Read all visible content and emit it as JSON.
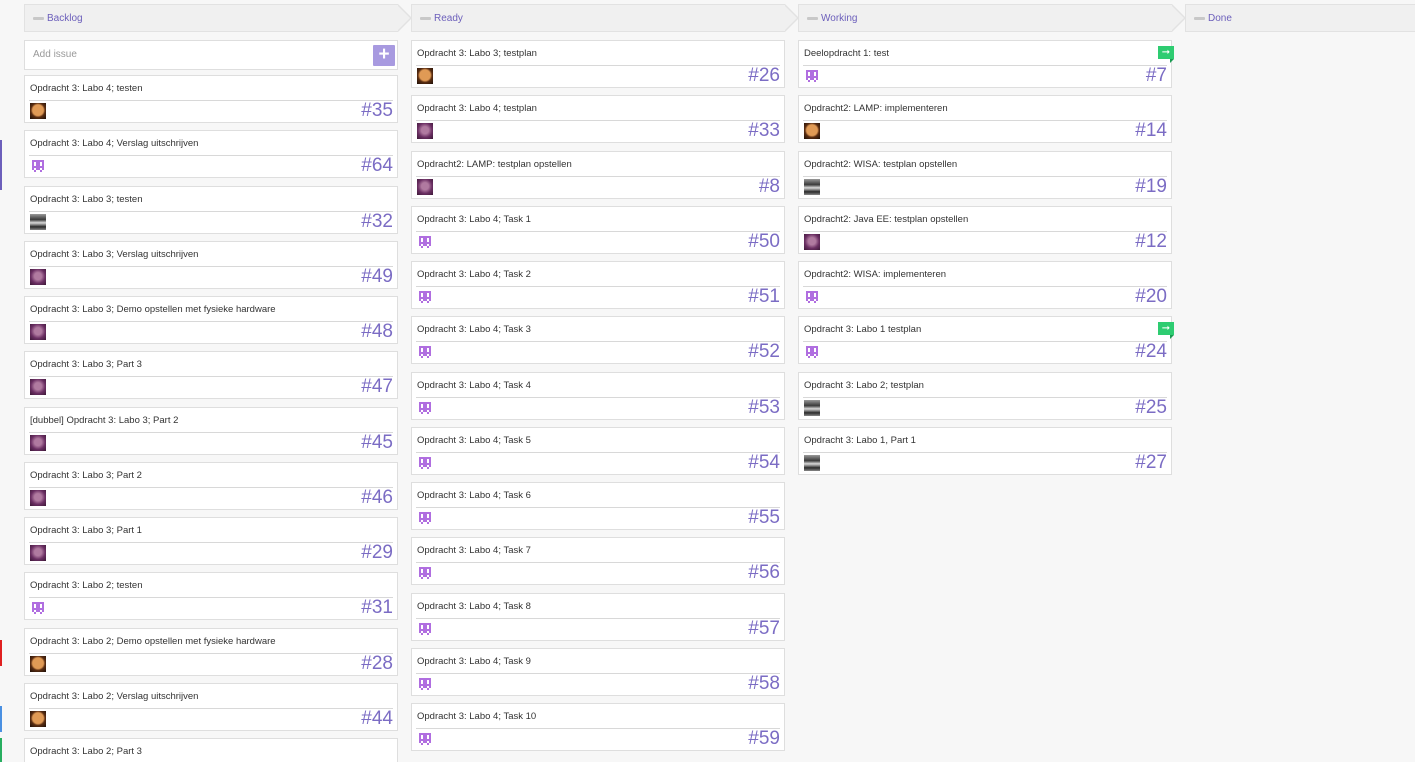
{
  "board": {
    "columns": [
      {
        "title": "Backlog",
        "add_issue_placeholder": "Add issue",
        "add_issue_button": "+",
        "cards": [
          {
            "title": "Opdracht 3: Labo 4; testen",
            "number": "#35",
            "avatar": "orange"
          },
          {
            "title": "Opdracht 3: Labo 4; Verslag uitschrijven",
            "number": "#64",
            "avatar": "ghost"
          },
          {
            "title": "Opdracht 3: Labo 3; testen",
            "number": "#32",
            "avatar": "gray"
          },
          {
            "title": "Opdracht 3: Labo 3; Verslag uitschrijven",
            "number": "#49",
            "avatar": "purple"
          },
          {
            "title": "Opdracht 3: Labo 3; Demo opstellen met fysieke hardware",
            "number": "#48",
            "avatar": "purple"
          },
          {
            "title": "Opdracht 3: Labo 3; Part 3",
            "number": "#47",
            "avatar": "purple"
          },
          {
            "title": "[dubbel] Opdracht 3: Labo 3; Part 2",
            "number": "#45",
            "avatar": "purple"
          },
          {
            "title": "Opdracht 3: Labo 3; Part 2",
            "number": "#46",
            "avatar": "purple"
          },
          {
            "title": "Opdracht 3: Labo 3; Part 1",
            "number": "#29",
            "avatar": "purple"
          },
          {
            "title": "Opdracht 3: Labo 2; testen",
            "number": "#31",
            "avatar": "ghost"
          },
          {
            "title": "Opdracht 3: Labo 2; Demo opstellen met fysieke hardware",
            "number": "#28",
            "avatar": "orange"
          },
          {
            "title": "Opdracht 3: Labo 2; Verslag uitschrijven",
            "number": "#44",
            "avatar": "orange"
          },
          {
            "title": "Opdracht 3: Labo 2; Part 3",
            "number": "",
            "avatar": "orange"
          }
        ]
      },
      {
        "title": "Ready",
        "cards": [
          {
            "title": "Opdracht 3: Labo 3; testplan",
            "number": "#26",
            "avatar": "orange"
          },
          {
            "title": "Opdracht 3: Labo 4; testplan",
            "number": "#33",
            "avatar": "purple"
          },
          {
            "title": "Opdracht2: LAMP: testplan opstellen",
            "number": "#8",
            "avatar": "purple"
          },
          {
            "title": "Opdracht 3: Labo 4; Task 1",
            "number": "#50",
            "avatar": "ghost"
          },
          {
            "title": "Opdracht 3: Labo 4; Task 2",
            "number": "#51",
            "avatar": "ghost"
          },
          {
            "title": "Opdracht 3: Labo 4; Task 3",
            "number": "#52",
            "avatar": "ghost"
          },
          {
            "title": "Opdracht 3: Labo 4; Task 4",
            "number": "#53",
            "avatar": "ghost"
          },
          {
            "title": "Opdracht 3: Labo 4; Task 5",
            "number": "#54",
            "avatar": "ghost"
          },
          {
            "title": "Opdracht 3: Labo 4; Task 6",
            "number": "#55",
            "avatar": "ghost"
          },
          {
            "title": "Opdracht 3: Labo 4; Task 7",
            "number": "#56",
            "avatar": "ghost"
          },
          {
            "title": "Opdracht 3: Labo 4; Task 8",
            "number": "#57",
            "avatar": "ghost"
          },
          {
            "title": "Opdracht 3: Labo 4; Task 9",
            "number": "#58",
            "avatar": "ghost"
          },
          {
            "title": "Opdracht 3: Labo 4; Task 10",
            "number": "#59",
            "avatar": "ghost"
          }
        ]
      },
      {
        "title": "Working",
        "cards": [
          {
            "title": "Deelopdracht 1: test",
            "number": "#7",
            "avatar": "ghost",
            "flag": "➞"
          },
          {
            "title": "Opdracht2: LAMP: implementeren",
            "number": "#14",
            "avatar": "orange"
          },
          {
            "title": "Opdracht2: WISA: testplan opstellen",
            "number": "#19",
            "avatar": "gray"
          },
          {
            "title": "Opdracht2: Java EE: testplan opstellen",
            "number": "#12",
            "avatar": "purple"
          },
          {
            "title": "Opdracht2: WISA: implementeren",
            "number": "#20",
            "avatar": "ghost"
          },
          {
            "title": "Opdracht 3: Labo 1 testplan",
            "number": "#24",
            "avatar": "ghost",
            "flag": "➞"
          },
          {
            "title": "Opdracht 3: Labo 2; testplan",
            "number": "#25",
            "avatar": "gray"
          },
          {
            "title": "Opdracht 3: Labo 1, Part 1",
            "number": "#27",
            "avatar": "gray"
          }
        ]
      },
      {
        "title": "Done",
        "cards": []
      }
    ]
  },
  "colors": {
    "accent": "#7b6cc4",
    "flag": "#2ecc71",
    "edge_markers": [
      "#6c5fbb",
      "#e02020",
      "#4a90e2",
      "#27ae60"
    ]
  }
}
